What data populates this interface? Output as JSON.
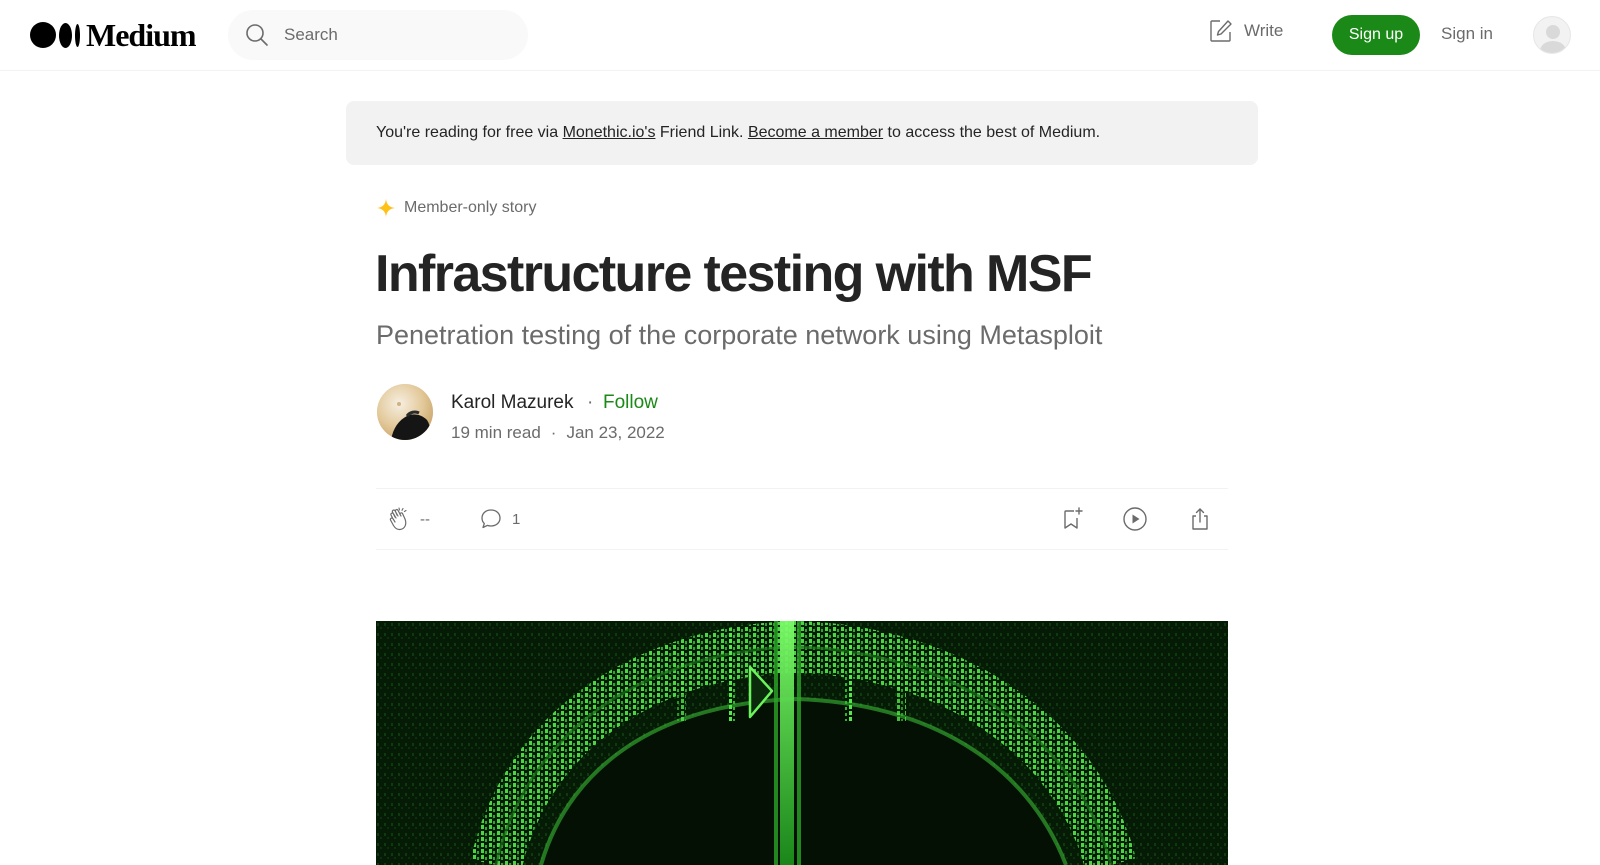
{
  "header": {
    "logo_text": "Medium",
    "search_placeholder": "Search",
    "write_label": "Write",
    "signup_label": "Sign up",
    "signin_label": "Sign in"
  },
  "banner": {
    "prefix": "You're reading for free via ",
    "friend_link": "Monethic.io's",
    "middle": " Friend Link. ",
    "member_link": "Become a member",
    "suffix": " to access the best of Medium."
  },
  "article": {
    "member_badge": "Member-only story",
    "title": "Infrastructure testing with MSF",
    "subtitle": "Penetration testing of the corporate network using Metasploit",
    "author": "Karol Mazurek",
    "separator": "·",
    "follow_label": "Follow",
    "read_time": "19 min read",
    "date": "Jan 23, 2022"
  },
  "actions": {
    "claps": "--",
    "responses": "1"
  },
  "colors": {
    "accent_green": "#1a8917",
    "star_yellow": "#ffc017",
    "banner_bg": "#f2f2f2",
    "hero_bg": "#061b06"
  },
  "icons": [
    "search-icon",
    "write-icon",
    "user-avatar-icon",
    "sparkle-star-icon",
    "clap-icon",
    "comment-icon",
    "bookmark-add-icon",
    "play-icon",
    "share-icon"
  ]
}
